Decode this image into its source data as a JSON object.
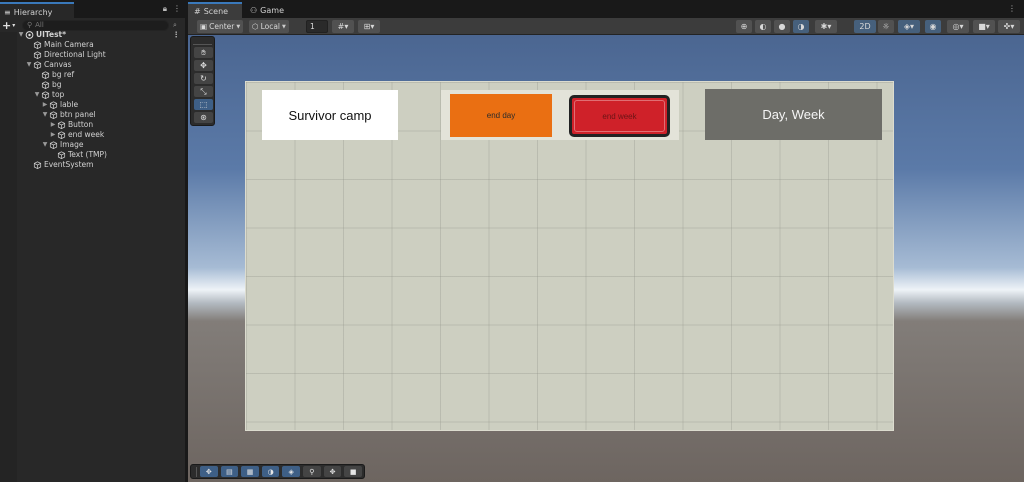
{
  "hierarchy": {
    "tab_label": "Hierarchy",
    "search_placeholder": "All",
    "items": [
      {
        "label": "UITest*",
        "depth": 0,
        "arrow": "▼",
        "kind": "scene"
      },
      {
        "label": "Main Camera",
        "depth": 1,
        "arrow": "",
        "kind": "object"
      },
      {
        "label": "Directional Light",
        "depth": 1,
        "arrow": "",
        "kind": "object"
      },
      {
        "label": "Canvas",
        "depth": 1,
        "arrow": "▼",
        "kind": "object"
      },
      {
        "label": "bg ref",
        "depth": 2,
        "arrow": "",
        "kind": "object"
      },
      {
        "label": "bg",
        "depth": 2,
        "arrow": "",
        "kind": "object"
      },
      {
        "label": "top",
        "depth": 2,
        "arrow": "▼",
        "kind": "object"
      },
      {
        "label": "lable",
        "depth": 3,
        "arrow": "▶",
        "kind": "object"
      },
      {
        "label": "btn panel",
        "depth": 3,
        "arrow": "▼",
        "kind": "object"
      },
      {
        "label": "Button",
        "depth": 4,
        "arrow": "▶",
        "kind": "object"
      },
      {
        "label": "end week",
        "depth": 4,
        "arrow": "▶",
        "kind": "object"
      },
      {
        "label": "Image",
        "depth": 3,
        "arrow": "▼",
        "kind": "object"
      },
      {
        "label": "Text (TMP)",
        "depth": 4,
        "arrow": "",
        "kind": "object"
      },
      {
        "label": "EventSystem",
        "depth": 1,
        "arrow": "",
        "kind": "object"
      }
    ]
  },
  "tabs": {
    "scene": "Scene",
    "game": "Game"
  },
  "scene_toolbar": {
    "pivot_mode": "Center",
    "pivot_rotation": "Local",
    "grid_snap_value": "1",
    "mode_2d": "2D"
  },
  "ui_canvas": {
    "title": "Survivor camp",
    "end_day_label": "end day",
    "end_week_label": "end week",
    "day_week_label": "Day, Week"
  },
  "colors": {
    "accent": "#3a79bb",
    "end_day": "#ea6f12",
    "end_week": "#cf2129",
    "day_box": "#6d6d68"
  }
}
